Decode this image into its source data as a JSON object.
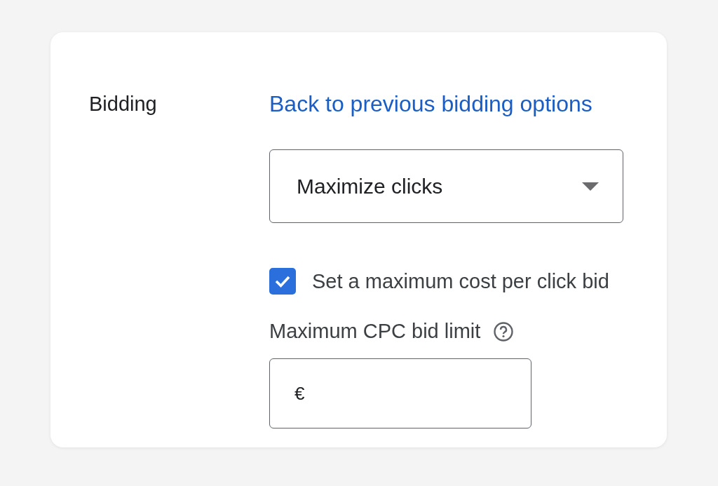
{
  "section": {
    "title": "Bidding",
    "back_link": "Back to previous bidding options"
  },
  "strategy_dropdown": {
    "value": "Maximize clicks"
  },
  "max_cpc_checkbox": {
    "label": "Set a maximum cost per click bid",
    "checked": true
  },
  "bid_limit": {
    "label": "Maximum CPC bid limit",
    "currency": "€"
  }
}
